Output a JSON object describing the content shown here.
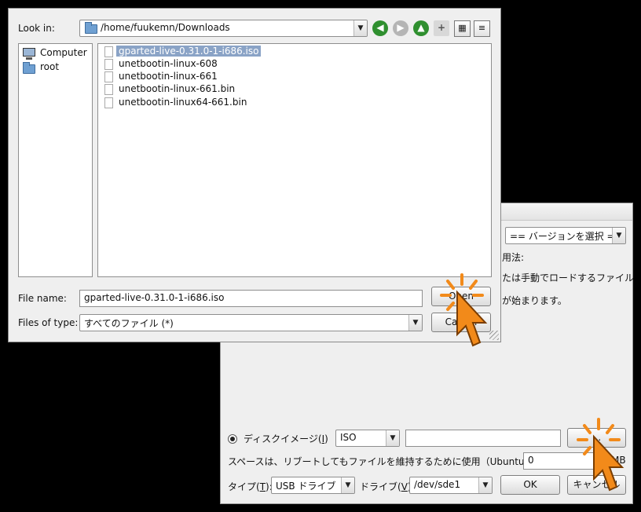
{
  "unetbootin": {
    "version_combo": "== バージョンを選択 ==",
    "instr_line1": "用法:",
    "instr_line2": "たは手動でロードするファイル",
    "instr_line3": "が始まります。",
    "disk_image_label": "ディスクイメージ(",
    "disk_image_key": "I",
    "disk_image_close": ")",
    "image_type": "ISO",
    "image_path": "",
    "browse_label": "...",
    "space_label": "スペースは、リブートしてもファイルを維持するために使用（Ubuntuのみ）:",
    "space_value": "0",
    "space_unit": "MB",
    "type_label": "タイプ(",
    "type_key": "T",
    "type_close": "):",
    "type_value": "USB ドライブ",
    "drive_label": "ドライブ(",
    "drive_key": "V",
    "drive_close": "):",
    "drive_value": "/dev/sde1",
    "ok_label": "OK",
    "cancel_label": "キャンセル"
  },
  "file_dialog": {
    "look_in_label": "Look in:",
    "look_in_path": "/home/fuukemn/Downloads",
    "toolbar_icons": [
      "back-icon",
      "forward-icon",
      "up-icon",
      "new-folder-icon",
      "detail-view-icon",
      "list-view-icon"
    ],
    "places": [
      {
        "label": "Computer",
        "icon": "computer-icon"
      },
      {
        "label": "root",
        "icon": "folder-icon"
      }
    ],
    "files": [
      {
        "name": "gparted-live-0.31.0-1-i686.iso",
        "selected": true
      },
      {
        "name": "unetbootin-linux-608",
        "selected": false
      },
      {
        "name": "unetbootin-linux-661",
        "selected": false
      },
      {
        "name": "unetbootin-linux-661.bin",
        "selected": false
      },
      {
        "name": "unetbootin-linux64-661.bin",
        "selected": false
      }
    ],
    "file_name_label": "File name:",
    "file_name_value": "gparted-live-0.31.0-1-i686.iso",
    "files_of_type_label": "Files of type:",
    "files_of_type_value": "すべてのファイル (*)",
    "open_label": "Open",
    "cancel_label": "Cancel"
  },
  "colors": {
    "selection": "#8aa3c6",
    "cursor_orange": "#f28a1a"
  }
}
